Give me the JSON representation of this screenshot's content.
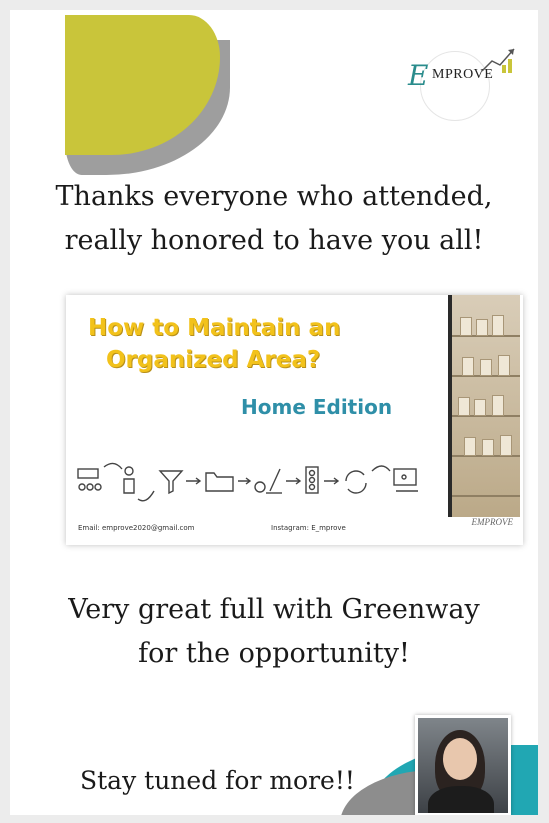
{
  "colors": {
    "accent_yellow": "#c9c53a",
    "accent_teal": "#21a7b3",
    "slide_title": "#f2c21b",
    "slide_subtitle": "#2f8fa8"
  },
  "logo": {
    "mark": "E",
    "text": "MPROVE"
  },
  "headline_top": {
    "line1": "Thanks everyone who attended,",
    "line2": "really honored to have you all!"
  },
  "slide": {
    "title_line1": "How to Maintain an",
    "title_line2": "Organized Area?",
    "subtitle": "Home Edition",
    "email": "Email: emprove2020@gmail.com",
    "instagram": "Instagram: E_mprove",
    "logo_small": "EMPROVE",
    "icons": [
      "meeting-icon",
      "person-icon",
      "filter-icon",
      "folder-icon",
      "cleaning-icon",
      "traffic-light-icon",
      "cycle-icon",
      "presentation-icon"
    ]
  },
  "headline_mid": {
    "line1": "Very great full with Greenway",
    "line2": "for the opportunity!"
  },
  "footer": {
    "text": "Stay tuned for more!!"
  }
}
